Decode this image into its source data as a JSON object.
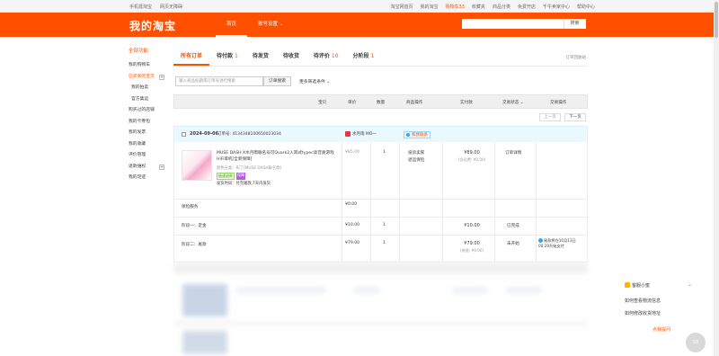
{
  "topbar": {
    "left": [
      "手机逛淘宝",
      "网页无障碍"
    ],
    "right": [
      "淘宝网首页",
      "我的淘宝",
      "购物车33",
      "收藏夹",
      "商品分类",
      "免费开店",
      "千牛卖家中心",
      "帮助中心"
    ]
  },
  "header": {
    "logo": "我的淘宝",
    "nav": [
      "首页",
      "账号设置 ⌄"
    ],
    "search_button": "搜索"
  },
  "sidebar": {
    "title": "全部功能",
    "items": [
      {
        "label": "我的购物车",
        "active": false,
        "sub": false,
        "plus": false
      },
      {
        "label": "已买到的宝贝",
        "active": true,
        "sub": false,
        "plus": true
      },
      {
        "label": "我的拍卖",
        "active": false,
        "sub": true,
        "plus": false
      },
      {
        "label": "官方集运",
        "active": false,
        "sub": true,
        "plus": false
      },
      {
        "label": "购买过的店铺",
        "active": false,
        "sub": false,
        "plus": false
      },
      {
        "label": "我的卡券包",
        "active": false,
        "sub": false,
        "plus": false
      },
      {
        "label": "我的发票",
        "active": false,
        "sub": false,
        "plus": false
      },
      {
        "label": "我的收藏",
        "active": false,
        "sub": false,
        "plus": false
      },
      {
        "label": "评价管理",
        "active": false,
        "sub": false,
        "plus": false
      },
      {
        "label": "退款维权",
        "active": false,
        "sub": false,
        "plus": true
      },
      {
        "label": "我的足迹",
        "active": false,
        "sub": false,
        "plus": false
      }
    ]
  },
  "tabs": [
    {
      "label": "所有订单",
      "count": ""
    },
    {
      "label": "待付款",
      "count": "1"
    },
    {
      "label": "待发货",
      "count": ""
    },
    {
      "label": "待收货",
      "count": ""
    },
    {
      "label": "待评价",
      "count": "10"
    },
    {
      "label": "分阶段",
      "count": "1"
    }
  ],
  "recycle": "订单回收站",
  "filter": {
    "placeholder": "输入商品标题或订单号进行搜索",
    "search_button": "订单搜索",
    "more": "更多筛选条件 ⌄"
  },
  "table_headers": [
    "宝贝",
    "单价",
    "数量",
    "商品操作",
    "实付款",
    "交易状态 ⌄",
    "交易操作"
  ],
  "pager": {
    "prev": "上一页",
    "next": "下一页"
  },
  "order": {
    "date": "2024-09-06",
    "number": "订单号: 4134348100650023034",
    "shop": "水月雨 MO一",
    "contact": "和我联系",
    "product": {
      "name": "MUSE DASH X水月雨联名号可Quark2入耳式typec高音质游戏HiFi耳机[全新保障]",
      "sku": "颜色分类：布丁[MUSE DASH联名款]",
      "tag1": "极速退款",
      "tag2": "保障",
      "delivery": "发货时间：付完尾款,7天内发货",
      "price": "¥85.00",
      "qty": "1",
      "ops": [
        "投诉卖家",
        "退运保险"
      ],
      "actual": "¥89.00",
      "actual_ship": "(含运费: ¥0.00)",
      "status": "订单详情"
    },
    "insurance": {
      "label": "保险服务",
      "price": "¥0.00"
    },
    "stage1": {
      "label": "阶段一：定金",
      "price": "¥10.00",
      "qty": "1",
      "actual": "¥10.00",
      "status": "已完成"
    },
    "stage2": {
      "label": "阶段二：尾款",
      "price": "¥79.00",
      "qty": "1",
      "actual": "¥79.00",
      "actual_ship": "(快递: ¥0.00)",
      "status": "未开始",
      "info": "尾款将在10月13日 00:29开始支付"
    }
  },
  "customer_service": {
    "title": "客服小蜜",
    "questions": [
      "如何查看物流信息",
      "如何修改收货地址"
    ],
    "more": "点我提问"
  },
  "float_button": "58"
}
